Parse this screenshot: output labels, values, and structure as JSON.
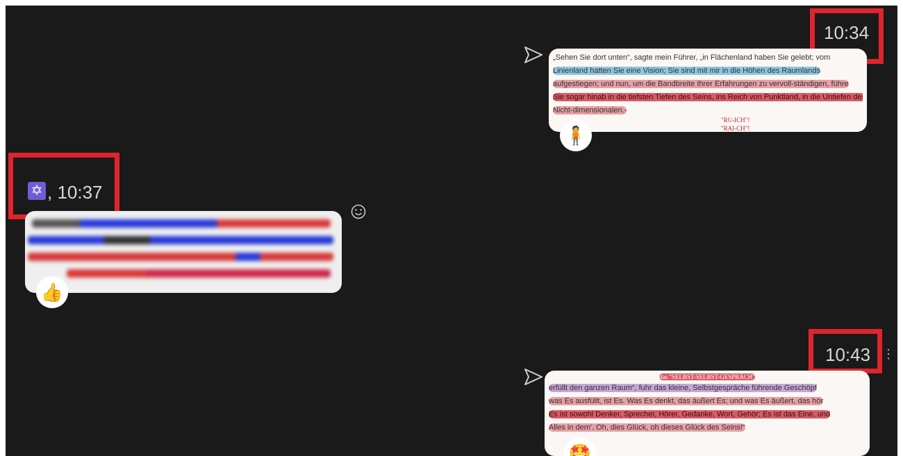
{
  "message_1": {
    "time": "10:34",
    "lines": [
      "„Sehen Sie dort unten“, sagte mein Führer, „in Flächenland haben Sie gelebt; vom",
      "Linienland hatten Sie eine Vision; Sie sind mit mir in die Höhen des Raumlands",
      "aufgestiegen; und nun, um die Bandbreite Ihrer Erfahrungen zu vervoll-ständigen, führe",
      "Sie sogar hinab in die tiefsten Tiefen des Seins, ins Reich von Punktland, in die Untiefen des",
      "Nicht-dimensionalen.-"
    ],
    "annotations": [
      "\"RU-ICH\"!",
      "\"RAI-CH\"!"
    ],
    "reaction": "🧍"
  },
  "message_2": {
    "sender_icon": "✡",
    "time_label": ", 10:37",
    "reaction": "👍"
  },
  "message_3": {
    "time": "10:43",
    "header_annotation": "das \"SELBST-SELBST-GESPRÄCH\"",
    "lines": [
      "erfüllt den ganzen Raum“, fuhr das kleine, Selbstgespräche führende Geschöpf",
      "was Es ausfüllt, ist Es. Was Es denkt, das äußert Es; und was Es äußert, das hör",
      "Es ist sowohl Denker, Sprecher, Hörer, Gedanke, Wort, Gehör; Es ist das Eine, und",
      "Alles in dem'. Oh, dies Glück, oh dieses Glück des Seins!“"
    ],
    "reaction": "🤩"
  },
  "colors": {
    "background": "#1a1a1a",
    "highlight_box": "#e0242b",
    "timestamp": "#d8d8d8"
  }
}
